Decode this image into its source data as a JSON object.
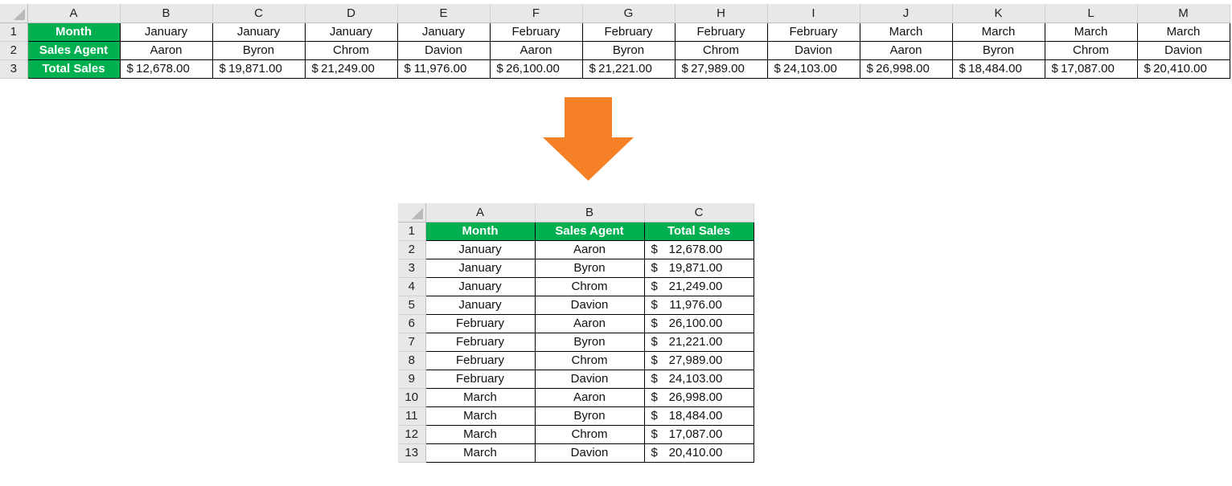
{
  "top_sheet": {
    "col_headers": [
      "A",
      "B",
      "C",
      "D",
      "E",
      "F",
      "G",
      "H",
      "I",
      "J",
      "K",
      "L",
      "M"
    ],
    "row_numbers": [
      "1",
      "2",
      "3"
    ],
    "row_labels": [
      "Month",
      "Sales Agent",
      "Total Sales"
    ],
    "months": [
      "January",
      "January",
      "January",
      "January",
      "February",
      "February",
      "February",
      "February",
      "March",
      "March",
      "March",
      "March"
    ],
    "agents": [
      "Aaron",
      "Byron",
      "Chrom",
      "Davion",
      "Aaron",
      "Byron",
      "Chrom",
      "Davion",
      "Aaron",
      "Byron",
      "Chrom",
      "Davion"
    ],
    "sales": [
      "12,678.00",
      "19,871.00",
      "21,249.00",
      "11,976.00",
      "26,100.00",
      "21,221.00",
      "27,989.00",
      "24,103.00",
      "26,998.00",
      "18,484.00",
      "17,087.00",
      "20,410.00"
    ],
    "currency_symbol": "$"
  },
  "arrow": {
    "icon": "down-arrow-icon",
    "color": "#f58025"
  },
  "bottom_sheet": {
    "col_headers": [
      "A",
      "B",
      "C"
    ],
    "header_row_number": "1",
    "headers": [
      "Month",
      "Sales Agent",
      "Total Sales"
    ],
    "currency_symbol": "$",
    "rows": [
      {
        "num": "2",
        "month": "January",
        "agent": "Aaron",
        "sales": "12,678.00"
      },
      {
        "num": "3",
        "month": "January",
        "agent": "Byron",
        "sales": "19,871.00"
      },
      {
        "num": "4",
        "month": "January",
        "agent": "Chrom",
        "sales": "21,249.00"
      },
      {
        "num": "5",
        "month": "January",
        "agent": "Davion",
        "sales": "11,976.00"
      },
      {
        "num": "6",
        "month": "February",
        "agent": "Aaron",
        "sales": "26,100.00"
      },
      {
        "num": "7",
        "month": "February",
        "agent": "Byron",
        "sales": "21,221.00"
      },
      {
        "num": "8",
        "month": "February",
        "agent": "Chrom",
        "sales": "27,989.00"
      },
      {
        "num": "9",
        "month": "February",
        "agent": "Davion",
        "sales": "24,103.00"
      },
      {
        "num": "10",
        "month": "March",
        "agent": "Aaron",
        "sales": "26,998.00"
      },
      {
        "num": "11",
        "month": "March",
        "agent": "Byron",
        "sales": "18,484.00"
      },
      {
        "num": "12",
        "month": "March",
        "agent": "Chrom",
        "sales": "17,087.00"
      },
      {
        "num": "13",
        "month": "March",
        "agent": "Davion",
        "sales": "20,410.00"
      }
    ]
  },
  "colors": {
    "header_green": "#00b050",
    "header_text": "#ffffff",
    "grid_header_bg": "#e8e8e8"
  }
}
